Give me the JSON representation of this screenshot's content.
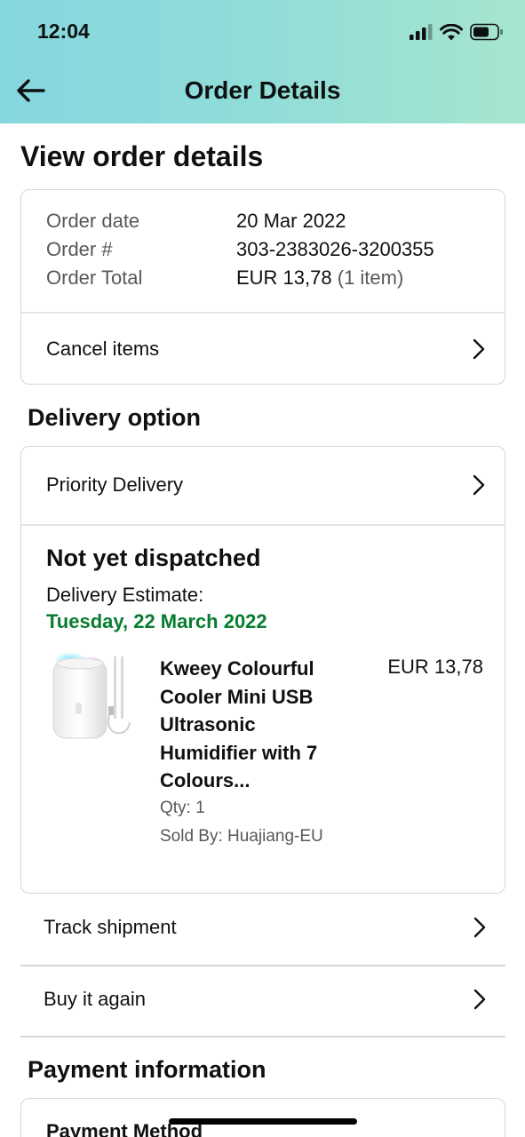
{
  "status_bar": {
    "time": "12:04"
  },
  "header": {
    "title": "Order Details"
  },
  "page": {
    "title": "View order details"
  },
  "order_summary": {
    "rows": [
      {
        "label": "Order date",
        "value": "20 Mar 2022",
        "extra": ""
      },
      {
        "label": "Order #",
        "value": "303-2383026-3200355",
        "extra": ""
      },
      {
        "label": "Order Total",
        "value": "EUR 13,78",
        "extra": "(1 item)"
      }
    ],
    "cancel_label": "Cancel items"
  },
  "delivery": {
    "section_title": "Delivery option",
    "option_label": "Priority Delivery",
    "status_title": "Not yet dispatched",
    "estimate_label": "Delivery Estimate:",
    "estimate_date": "Tuesday, 22 March 2022",
    "item": {
      "name": "Kweey Colourful Cooler Mini USB Ultrasonic Humidifier with 7 Colours...",
      "price": "EUR 13,78",
      "qty": "Qty: 1",
      "seller": "Sold By: Huajiang-EU"
    },
    "status_color": "#067d2f"
  },
  "actions": {
    "track_label": "Track shipment",
    "buy_again_label": "Buy it again"
  },
  "payment": {
    "section_title": "Payment information",
    "method_label": "Payment Method"
  },
  "icons": {
    "back": "arrow-left-icon",
    "chevron": "chevron-right-icon"
  }
}
